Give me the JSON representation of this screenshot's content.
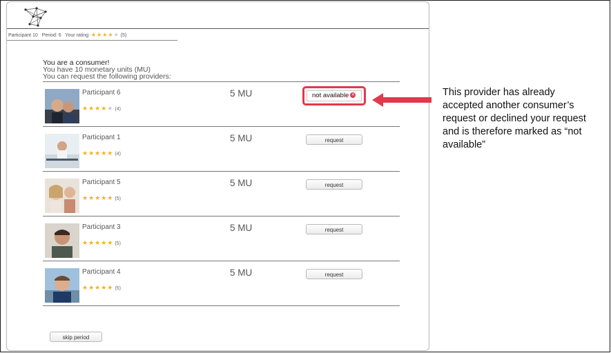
{
  "status_bar": {
    "participant": "Participant 10",
    "period": "Period: 6",
    "rating_label": "Your rating:",
    "rating_stars": "★★★★",
    "rating_empty": "★",
    "rating_count": "(5)"
  },
  "intro": {
    "line1": "You are a consumer!",
    "line2": "You have 10 monetary units (MU)",
    "line3": "You can request the following providers:"
  },
  "providers": [
    {
      "name": "Participant 6",
      "stars_full": "★★★★",
      "stars_empty": "★",
      "count": "(4)",
      "price": "5 MU",
      "action": "not available",
      "available": false
    },
    {
      "name": "Participant 1",
      "stars_full": "★★★★★",
      "stars_empty": "",
      "count": "(4)",
      "price": "5 MU",
      "action": "request",
      "available": true
    },
    {
      "name": "Participant 5",
      "stars_full": "★★★★★",
      "stars_empty": "",
      "count": "(5)",
      "price": "5 MU",
      "action": "request",
      "available": true
    },
    {
      "name": "Participant 3",
      "stars_full": "★★★★★",
      "stars_empty": "",
      "count": "(5)",
      "price": "5 MU",
      "action": "request",
      "available": true
    },
    {
      "name": "Participant 4",
      "stars_full": "★★★★★",
      "stars_empty": "",
      "count": "(5)",
      "price": "5 MU",
      "action": "request",
      "available": true
    }
  ],
  "skip_label": "skip period",
  "annotation": {
    "text": "This provider has already accepted another consumer’s request or declined your request and is therefore marked as “not available”"
  },
  "colors": {
    "highlight": "#e03a4b",
    "star": "#f3b21b"
  }
}
